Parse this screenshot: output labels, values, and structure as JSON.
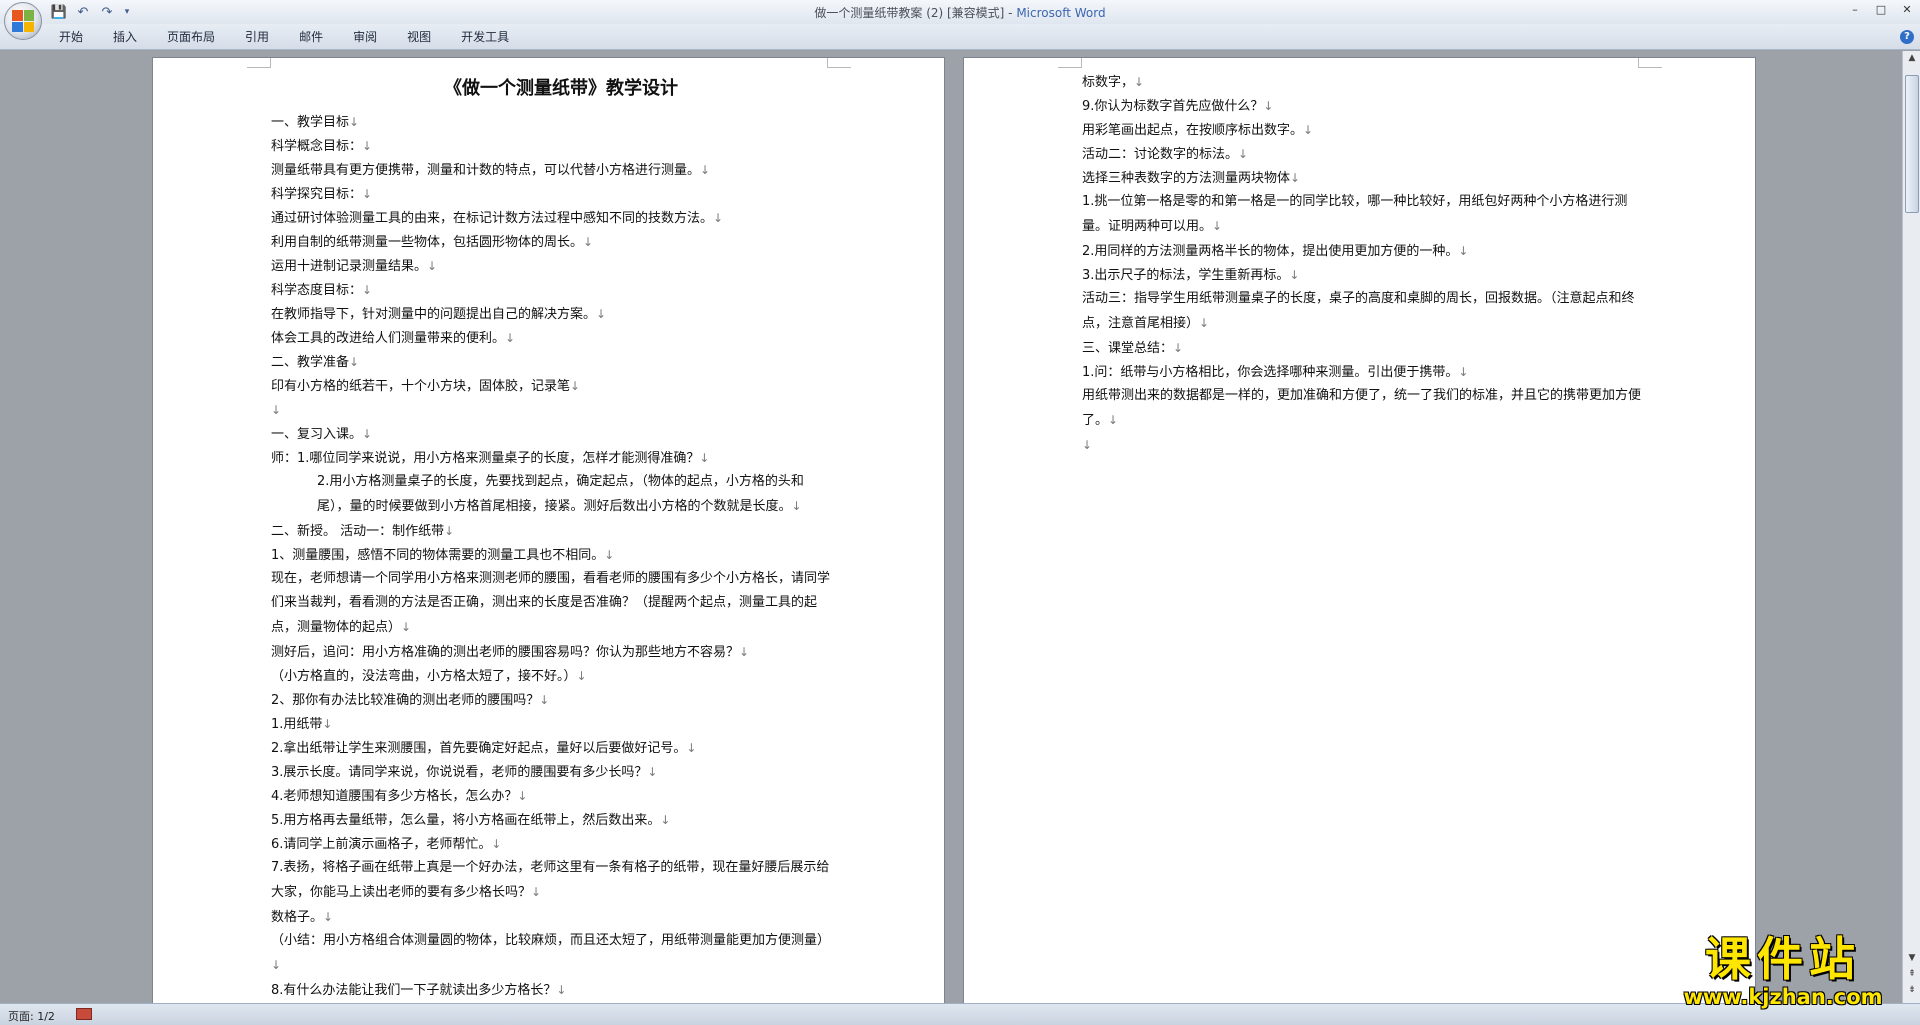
{
  "window": {
    "title_prefix": "做一个测量纸带教案 (2) [兼容模式] - ",
    "title_app": "Microsoft Word",
    "minimize": "–",
    "maximize": "□",
    "close": "✕"
  },
  "quick_access": {
    "save": "💾",
    "undo": "↶",
    "redo": "↷",
    "customize": "▾"
  },
  "ribbon": {
    "tabs": [
      "开始",
      "插入",
      "页面布局",
      "引用",
      "邮件",
      "审阅",
      "视图",
      "开发工具"
    ],
    "help": "?"
  },
  "page1": {
    "title": "《做一个测量纸带》教学设计",
    "paragraphs": [
      "一、教学目标",
      "科学概念目标：",
      "测量纸带具有更方便携带，测量和计数的特点，可以代替小方格进行测量。",
      "科学探究目标：",
      "通过研讨体验测量工具的由来，在标记计数方法过程中感知不同的技数方法。",
      "利用自制的纸带测量一些物体，包括圆形物体的周长。",
      "运用十进制记录测量结果。",
      "科学态度目标：",
      "在教师指导下，针对测量中的问题提出自己的解决方案。",
      "体会工具的改进给人们测量带来的便利。",
      "二、教学准备",
      "印有小方格的纸若干，十个小方块，固体胶，记录笔",
      "",
      "一、复习入课。",
      "师：1.哪位同学来说说，用小方格来测量桌子的长度，怎样才能测得准确？",
      "2.用小方格测量桌子的长度，先要找到起点，确定起点，（物体的起点，小方格的头和尾），量的时候要做到小方格首尾相接，接紧。测好后数出小方格的个数就是长度。",
      "二、新授。     活动一：制作纸带",
      "1、测量腰围，感悟不同的物体需要的测量工具也不相同。",
      "现在，老师想请一个同学用小方格来测测老师的腰围，看看老师的腰围有多少个小方格长，请同学们来当裁判，看看测的方法是否正确，测出来的长度是否准确？（提醒两个起点，测量工具的起点，测量物体的起点）",
      "测好后，追问：用小方格准确的测出老师的腰围容易吗？你认为那些地方不容易？",
      "（小方格直的，没法弯曲，小方格太短了，接不好。）",
      "2、那你有办法比较准确的测出老师的腰围吗？",
      "1.用纸带",
      "2.拿出纸带让学生来测腰围，首先要确定好起点，量好以后要做好记号。",
      "3.展示长度。请同学来说，你说说看，老师的腰围要有多少长吗？",
      "4.老师想知道腰围有多少方格长，怎么办？",
      "5.用方格再去量纸带，怎么量，将小方格画在纸带上，然后数出来。",
      "6.请同学上前演示画格子，老师帮忙。",
      "7.表扬，将格子画在纸带上真是一个好办法，老师这里有一条有格子的纸带，现在量好腰后展示给大家，你能马上读出老师的要有多少格长吗？",
      "数格子。",
      "（小结：用小方格组合体测量圆的物体，比较麻烦，而且还太短了，用纸带测量能更加方便测量）",
      "8.有什么办法能让我们一下子就读出多少方格长？"
    ]
  },
  "page2": {
    "paragraphs": [
      "标数字，",
      "9.你认为标数字首先应做什么？",
      "用彩笔画出起点，在按顺序标出数字。",
      "活动二：讨论数字的标法。",
      "选择三种表数字的方法测量两块物体",
      "1.挑一位第一格是零的和第一格是一的同学比较，哪一种比较好，用纸包好两种个小方格进行测量。证明两种可以用。",
      "2.用同样的方法测量两格半长的物体，提出使用更加方便的一种。",
      "3.出示尺子的标法，学生重新再标。",
      "活动三：指导学生用纸带测量桌子的长度，桌子的高度和桌脚的周长，回报数据。（注意起点和终点，注意首尾相接）",
      "三、课堂总结：",
      "1.问：纸带与小方格相比，你会选择哪种来测量。引出便于携带。",
      "用纸带测出来的数据都是一样的，更加准确和方便了，统一了我们的标准，并且它的携带更加方便了。",
      ""
    ]
  },
  "status": {
    "page": "页面: 1/2"
  },
  "watermark": {
    "name": "课件站",
    "url": "www.kjzhan.com"
  },
  "colors": {
    "title_app": "#3c66b0",
    "watermark": "#ffe600",
    "page_bg": "#ffffff",
    "workspace": "#9da1a8"
  }
}
